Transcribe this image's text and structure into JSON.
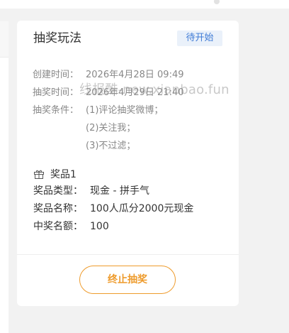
{
  "card": {
    "title": "抽奖玩法",
    "status": "待开始",
    "watermark": "线报酷-new.xianbao.fun",
    "info": {
      "created_label": "创建时间：",
      "created_value": "2026年4月28日 09:49",
      "draw_label": "抽奖时间：",
      "draw_value": "2026年4月29日 21:40",
      "conditions_label": "抽奖条件：",
      "conditions": [
        "(1)评论抽奖微博；",
        "(2)关注我；",
        "(3)不过滤；"
      ]
    },
    "prize": {
      "heading": "奖品1",
      "icon": "gift-icon",
      "type_label": "奖品类型：",
      "type_value": "现金 - 拼手气",
      "name_label": "奖品名称：",
      "name_value": "100人瓜分2000元现金",
      "count_label": "中奖名额：",
      "count_value": "100"
    },
    "button_label": "终止抽奖"
  },
  "colors": {
    "accent_orange": "#ee9b2c",
    "status_blue": "#3f7bd6",
    "status_bg": "#eaf1fa"
  }
}
